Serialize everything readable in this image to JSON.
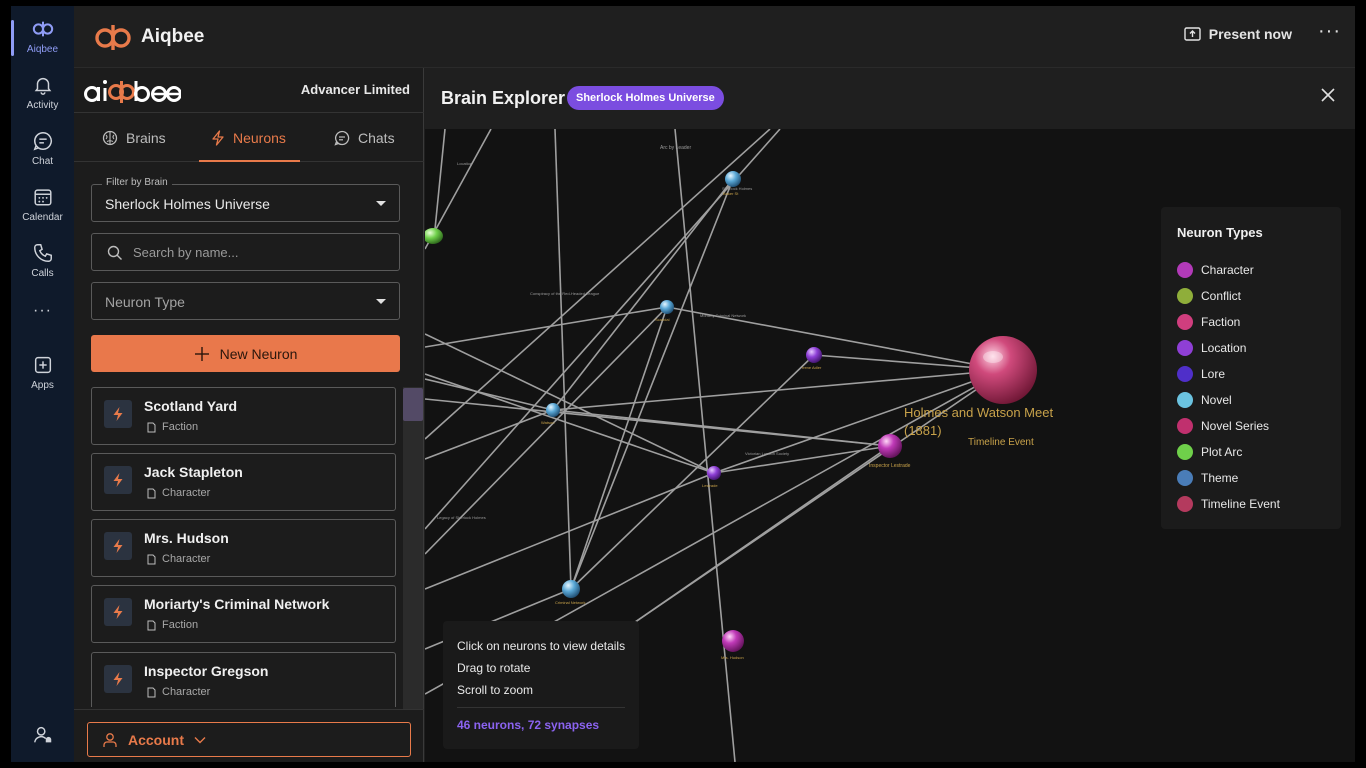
{
  "rail": {
    "items": [
      {
        "label": "Aiqbee",
        "icon": "aiqbee-logo-icon"
      },
      {
        "label": "Activity",
        "icon": "bell-icon"
      },
      {
        "label": "Chat",
        "icon": "chat-icon"
      },
      {
        "label": "Calendar",
        "icon": "calendar-icon"
      },
      {
        "label": "Calls",
        "icon": "phone-icon"
      },
      {
        "label": "Apps",
        "icon": "apps-icon"
      }
    ],
    "more": "···"
  },
  "topbar": {
    "app_title": "Aiqbee",
    "present_label": "Present now",
    "more": "···"
  },
  "panel": {
    "company": "Advancer Limited",
    "tabs": [
      {
        "label": "Brains"
      },
      {
        "label": "Neurons"
      },
      {
        "label": "Chats"
      }
    ],
    "filter_label": "Filter by Brain",
    "filter_value": "Sherlock Holmes Universe",
    "search_placeholder": "Search by name...",
    "type_placeholder": "Neuron Type",
    "new_button": "New Neuron",
    "neurons": [
      {
        "name": "Scotland Yard",
        "type": "Faction"
      },
      {
        "name": "Jack Stapleton",
        "type": "Character"
      },
      {
        "name": "Mrs. Hudson",
        "type": "Character"
      },
      {
        "name": "Moriarty's Criminal Network",
        "type": "Faction"
      },
      {
        "name": "Inspector Gregson",
        "type": "Character"
      }
    ],
    "account_label": "Account"
  },
  "explorer": {
    "title": "Brain Explorer",
    "badge": "Sherlock Holmes Universe",
    "selected_node": {
      "name": "Holmes and Watson Meet",
      "name_line2": "(1881)",
      "type": "Timeline Event"
    },
    "legend_title": "Neuron Types",
    "legend": [
      {
        "label": "Character",
        "color": "#b23ab8"
      },
      {
        "label": "Conflict",
        "color": "#8fae3a"
      },
      {
        "label": "Faction",
        "color": "#d03e7e"
      },
      {
        "label": "Location",
        "color": "#8f3fd6"
      },
      {
        "label": "Lore",
        "color": "#4f2fc9"
      },
      {
        "label": "Novel",
        "color": "#6bc3e0"
      },
      {
        "label": "Novel Series",
        "color": "#c0306e"
      },
      {
        "label": "Plot Arc",
        "color": "#6fd04a"
      },
      {
        "label": "Theme",
        "color": "#4a7db8"
      },
      {
        "label": "Timeline Event",
        "color": "#b43a5e"
      }
    ],
    "help": {
      "line1": "Click on neurons to view details",
      "line2": "Drag to rotate",
      "line3": "Scroll to zoom",
      "stats": "46 neurons, 72 synapses"
    }
  }
}
